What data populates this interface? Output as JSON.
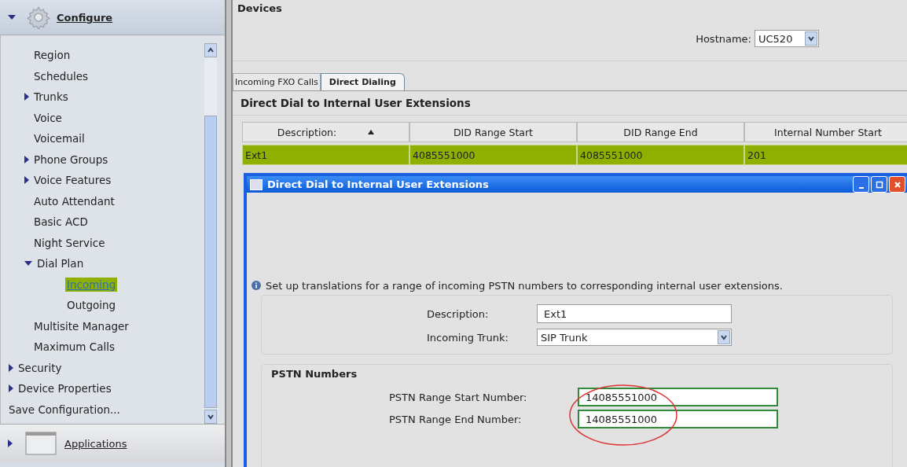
{
  "sidebar": {
    "header": {
      "label": "Configure",
      "expanded": true
    },
    "items": [
      {
        "label": "Region"
      },
      {
        "label": "Schedules"
      },
      {
        "label": "Trunks",
        "expanded": false
      },
      {
        "label": "Voice"
      },
      {
        "label": "Voicemail"
      },
      {
        "label": "Phone Groups",
        "expanded": false
      },
      {
        "label": "Voice Features",
        "expanded": false
      },
      {
        "label": "Auto Attendant"
      },
      {
        "label": "Basic ACD"
      },
      {
        "label": "Night Service"
      },
      {
        "label": "Dial Plan",
        "expanded": true,
        "children": [
          {
            "label": "Incoming",
            "selected": true
          },
          {
            "label": "Outgoing",
            "selected": false
          }
        ]
      },
      {
        "label": "Multisite Manager"
      },
      {
        "label": "Maximum Calls"
      }
    ],
    "top_items": [
      {
        "label": "Security",
        "expanded": false
      },
      {
        "label": "Device Properties",
        "expanded": false
      },
      {
        "label": "Save Configuration..."
      }
    ],
    "footer": {
      "label": "Applications",
      "expanded": false
    }
  },
  "devices": {
    "title": "Devices",
    "hostname_label": "Hostname:",
    "hostname": "UC520"
  },
  "tabs": [
    {
      "label": "Incoming FXO Calls",
      "selected": false
    },
    {
      "label": "Direct Dialing",
      "selected": true
    }
  ],
  "section_title": "Direct Dial to Internal User Extensions",
  "table": {
    "columns": [
      {
        "label": "Description:",
        "sorted": true
      },
      {
        "label": "DID Range Start",
        "sorted": false
      },
      {
        "label": "DID Range End",
        "sorted": false
      },
      {
        "label": "Internal Number Start",
        "sorted": false
      }
    ],
    "rows": [
      {
        "cells": [
          "Ext1",
          "4085551000",
          "4085551000",
          "201"
        ],
        "selected": true
      }
    ]
  },
  "dialog": {
    "title": "Direct Dial to Internal User Extensions",
    "info": "Set up translations for a range of incoming PSTN numbers to corresponding internal user extensions.",
    "description_label": "Description:",
    "description": "Ext1",
    "trunk_label": "Incoming Trunk:",
    "trunk": "SIP Trunk",
    "pstn_title": "PSTN Numbers",
    "start_label": "PSTN Range Start Number:",
    "start": "14085551000",
    "end_label": "PSTN Range End Number:",
    "end": "14085551000"
  }
}
